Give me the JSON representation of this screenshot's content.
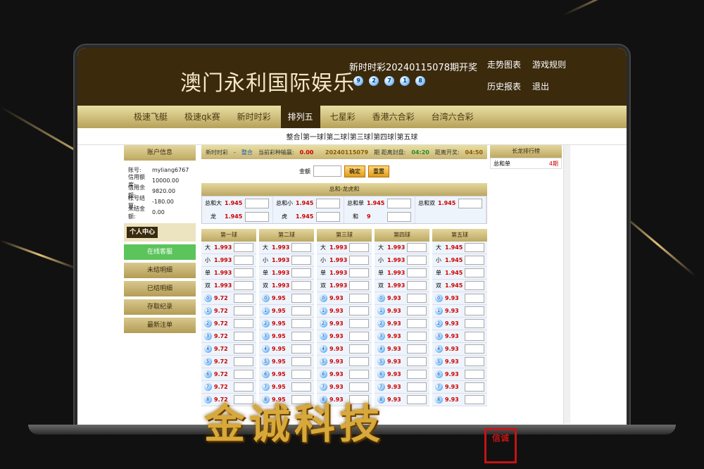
{
  "header": {
    "brand": "澳门永利国际娱乐",
    "draw_title": "新时时彩20240115078期开奖",
    "balls": [
      "9",
      "2",
      "7",
      "1",
      "8"
    ],
    "links": [
      "走势图表",
      "游戏规则",
      "历史报表",
      "退出"
    ]
  },
  "nav": {
    "items": [
      "极速飞艇",
      "极速qk赛",
      "新时时彩",
      "排列五",
      "七星彩",
      "香港六合彩",
      "台湾六合彩"
    ],
    "active_index": 3
  },
  "subnav": [
    "整合",
    "第一球",
    "第二球",
    "第三球",
    "第四球",
    "第五球"
  ],
  "account": {
    "title": "账户信息",
    "rows": [
      {
        "k": "账号:",
        "v": "myliang6767"
      },
      {
        "k": "信用额度:",
        "v": "10000.00"
      },
      {
        "k": "信用余额:",
        "v": "9820.00"
      },
      {
        "k": "帐号结算:",
        "v": "-180.00"
      },
      {
        "k": "未结金额:",
        "v": "0.00"
      }
    ]
  },
  "personal": {
    "title": "个人中心",
    "items": [
      "在线客服",
      "未结明细",
      "已结明细",
      "存取纪录",
      "最新注单"
    ]
  },
  "info": {
    "game": "新时时彩",
    "sep": "-",
    "mode": "整合",
    "win_label": "当前彩种输赢:",
    "win": "0.00",
    "period": "20240115079",
    "close_label": "期 距离封盘:",
    "close": "04:20",
    "open_label": "距离开奖:",
    "open": "04:50"
  },
  "amount": {
    "label": "金额",
    "ok": "确定",
    "reset": "重置"
  },
  "sum": {
    "title": "总和-龙虎和",
    "cells": [
      {
        "n": "总和大",
        "o": "1.945"
      },
      {
        "n": "总和小",
        "o": "1.945"
      },
      {
        "n": "总和单",
        "o": "1.945"
      },
      {
        "n": "总和双",
        "o": "1.945"
      },
      {
        "n": "龙",
        "o": "1.945"
      },
      {
        "n": "虎",
        "o": "1.945"
      },
      {
        "n": "和",
        "o": "9"
      },
      {
        "n": "",
        "o": ""
      }
    ]
  },
  "balls_cols": [
    {
      "title": "第一球",
      "big": [
        "1.993",
        "1.993",
        "1.993",
        "1.993"
      ],
      "num": "9.72"
    },
    {
      "title": "第二球",
      "big": [
        "1.993",
        "1.993",
        "1.993",
        "1.993"
      ],
      "num": "9.95"
    },
    {
      "title": "第三球",
      "big": [
        "1.993",
        "1.993",
        "1.993",
        "1.993"
      ],
      "num": "9.93"
    },
    {
      "title": "第四球",
      "big": [
        "1.993",
        "1.993",
        "1.993",
        "1.993"
      ],
      "num": "9.93"
    },
    {
      "title": "第五球",
      "big": [
        "1.945",
        "1.945",
        "1.945",
        "1.945"
      ],
      "num": "9.93"
    }
  ],
  "bs_labels": [
    "大",
    "小",
    "单",
    "双"
  ],
  "digits": [
    "0",
    "1",
    "2",
    "3",
    "4",
    "5",
    "6",
    "7",
    "8"
  ],
  "dragon": {
    "title": "长龙排行榜",
    "rows": [
      {
        "k": "总和单",
        "v": "4期"
      }
    ]
  },
  "watermark": "金诚科技",
  "seal": "信诚"
}
